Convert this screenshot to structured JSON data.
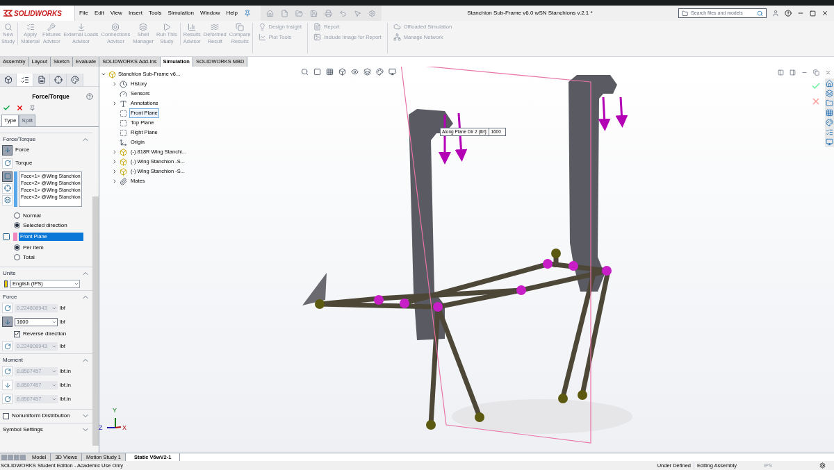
{
  "app": {
    "logo_text": "SOLIDWORKS",
    "menu": [
      "File",
      "Edit",
      "View",
      "Insert",
      "Tools",
      "Simulation",
      "Window",
      "Help"
    ],
    "document_title": "Stanchion Sub-Frame v6.0 wSN Stanchions v.2.1 *",
    "search": {
      "placeholder": "Search files and models"
    }
  },
  "ribbon": {
    "large_buttons": [
      {
        "lines": [
          "New",
          "Study"
        ],
        "disabled": true,
        "kind": "search"
      },
      {
        "lines": [
          "Apply",
          "Material"
        ],
        "disabled": true,
        "kind": "list"
      },
      {
        "lines": [
          "Fixtures",
          "Advisor"
        ],
        "disabled": true,
        "kind": "fix"
      },
      {
        "lines": [
          "External Loads",
          "Advisor"
        ],
        "disabled": true,
        "kind": "load"
      },
      {
        "lines": [
          "Connections",
          "Advisor"
        ],
        "disabled": true,
        "kind": "bolt"
      },
      {
        "lines": [
          "Shell",
          "Manager"
        ],
        "disabled": true,
        "kind": "shell"
      },
      {
        "lines": [
          "Run This",
          "Study"
        ],
        "disabled": true,
        "kind": "run"
      },
      {
        "lines": [
          "Results",
          "Advisor"
        ],
        "disabled": true,
        "kind": "results"
      },
      {
        "lines": [
          "Deformed",
          "Result"
        ],
        "disabled": true,
        "kind": "deform"
      },
      {
        "lines": [
          "Compare",
          "Results"
        ],
        "disabled": true,
        "kind": "compare"
      }
    ],
    "small_buttons": [
      [
        {
          "label": "Design Insight",
          "disabled": true
        },
        {
          "label": "Plot Tools",
          "disabled": true
        }
      ],
      [
        {
          "label": "Report",
          "disabled": true
        },
        {
          "label": "Include Image for Report",
          "disabled": true
        }
      ],
      [
        {
          "label": "Offloaded Simulation",
          "disabled": true
        },
        {
          "label": "Manage Network",
          "disabled": true
        }
      ]
    ]
  },
  "command_tabs": [
    {
      "label": "Assembly",
      "selected": false
    },
    {
      "label": "Layout",
      "selected": false
    },
    {
      "label": "Sketch",
      "selected": false
    },
    {
      "label": "Evaluate",
      "selected": false
    },
    {
      "label": "SOLIDWORKS Add-Ins",
      "selected": false
    },
    {
      "label": "Simulation",
      "selected": true
    },
    {
      "label": "SOLIDWORKS MBD",
      "selected": false
    }
  ],
  "property_manager": {
    "title": "Force/Torque",
    "tabs": [
      {
        "label": "Type",
        "selected": true
      },
      {
        "label": "Split",
        "selected": false
      }
    ],
    "force_torque": {
      "heading": "Force/Torque",
      "expanded": true,
      "options": [
        {
          "label": "Force",
          "selected": true
        },
        {
          "label": "Torque",
          "selected": false
        }
      ],
      "faces": [
        "Face<1> @Wing Stanchion",
        "Face<2> @Wing Stanchion",
        "Face<1> @Wing Stanchion",
        "Face<2> @Wing Stanchion"
      ],
      "direction": [
        {
          "label": "Normal",
          "selected": false
        },
        {
          "label": "Selected direction",
          "selected": true
        }
      ],
      "direction_reference": "Front Plane",
      "distribution": [
        {
          "label": "Per item",
          "selected": true
        },
        {
          "label": "Total",
          "selected": false
        }
      ]
    },
    "units": {
      "heading": "Units",
      "expanded": true,
      "value": "English (IPS)"
    },
    "force": {
      "heading": "Force",
      "expanded": true,
      "rows": [
        {
          "kind": "field",
          "value": "0.224808943",
          "unit": "lbf",
          "disabled": true,
          "selected": false
        },
        {
          "kind": "field",
          "value": "1600",
          "unit": "lbf",
          "disabled": false,
          "selected": true
        },
        {
          "kind": "checkbox",
          "label": "Reverse direction",
          "checked": true
        },
        {
          "kind": "field",
          "value": "0.224808943",
          "unit": "lbf",
          "disabled": true,
          "selected": false
        }
      ]
    },
    "moment": {
      "heading": "Moment",
      "expanded": true,
      "rows": [
        {
          "kind": "field",
          "value": "8.8507457",
          "unit": "lbf.in",
          "disabled": true,
          "selected": false
        },
        {
          "kind": "field",
          "value": "8.8507457",
          "unit": "lbf.in",
          "disabled": true,
          "selected": false
        },
        {
          "kind": "field",
          "value": "8.8507457",
          "unit": "lbf.in",
          "disabled": true,
          "selected": false
        }
      ]
    },
    "nonuniform": {
      "label": "Nonuniform Distribution",
      "checked": false,
      "expanded": false
    },
    "symbol_settings": {
      "heading": "Symbol Settings",
      "expanded": false
    }
  },
  "tree": {
    "label": "Stanchion Sub-Frame v6...",
    "expanded": true,
    "children": [
      {
        "label": "History",
        "kind": "history",
        "expandable": true,
        "selected": false
      },
      {
        "label": "Sensors",
        "kind": "sensors",
        "expandable": false,
        "selected": false
      },
      {
        "label": "Annotations",
        "kind": "annotations",
        "expandable": true,
        "selected": false
      },
      {
        "label": "Front Plane",
        "kind": "plane",
        "expandable": false,
        "selected": true
      },
      {
        "label": "Top Plane",
        "kind": "plane",
        "expandable": false,
        "selected": false
      },
      {
        "label": "Right Plane",
        "kind": "plane",
        "expandable": false,
        "selected": false
      },
      {
        "label": "Origin",
        "kind": "origin",
        "expandable": false,
        "selected": false
      },
      {
        "label": "(-) 818R Wing Stanchi...",
        "kind": "component",
        "expandable": true,
        "selected": false
      },
      {
        "label": "(-) Wing Stanchion -S...",
        "kind": "component",
        "expandable": true,
        "selected": false
      },
      {
        "label": "(-) Wing Stanchion -S...",
        "kind": "component",
        "expandable": true,
        "selected": false
      },
      {
        "label": "Mates",
        "kind": "mates",
        "expandable": true,
        "selected": false
      }
    ]
  },
  "viewport": {
    "callout": {
      "label": "Along Plane Dir 2 (lbf):",
      "value": "1600"
    },
    "triad": [
      "Y",
      "Z",
      "X"
    ]
  },
  "bottom_tabs": [
    {
      "label": "Model",
      "selected": false
    },
    {
      "label": "3D Views",
      "selected": false
    },
    {
      "label": "Motion Study 1",
      "selected": false
    },
    {
      "label": "Static V6wV2-1",
      "selected": true
    }
  ],
  "status_bar": {
    "edition": "SOLIDWORKS Student Edition - Academic Use Only",
    "state": "Under Defined",
    "mode": "Editing Assembly",
    "units": "IPS"
  }
}
